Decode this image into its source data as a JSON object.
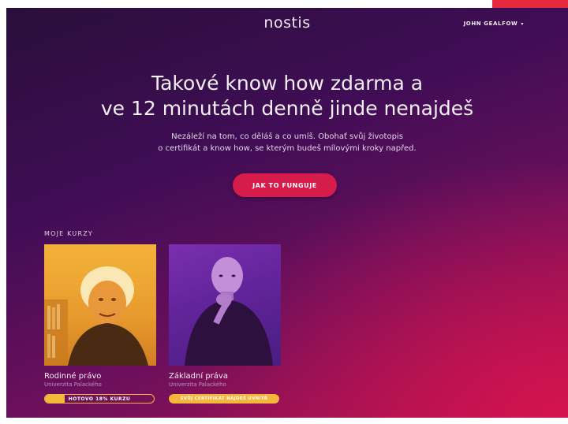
{
  "header": {
    "logo": "nostis",
    "user_name": "JOHN GEALFOW",
    "user_caret": "▾"
  },
  "hero": {
    "headline_line1": "Takové know how zdarma a",
    "headline_line2": "ve 12 minutách denně jinde nenajdeš",
    "subtext_line1": "Nezáleží na tom, co děláš a co umíš. Obohať svůj životopis",
    "subtext_line2": "o certifikát a know how, se kterým budeš mílovými kroky napřed.",
    "cta_label": "JAK TO FUNGUJE"
  },
  "courses_section": {
    "label": "MOJE KURZY",
    "courses": [
      {
        "title": "Rodinné právo",
        "institution": "Univerzita Palackého",
        "status_label": "HOTOVO 18% KURZU",
        "progress": 0.18
      },
      {
        "title": "Základní práva",
        "institution": "Univerzita Palackého",
        "status_label": "SVŮJ CERTIFIKÁT NAJDEŠ UVNITŘ"
      }
    ]
  },
  "colors": {
    "accent_red": "#d51c4a",
    "accent_yellow": "#f3b93c",
    "bg_dark": "#3f0d55",
    "bg_magenta": "#a8124f"
  }
}
